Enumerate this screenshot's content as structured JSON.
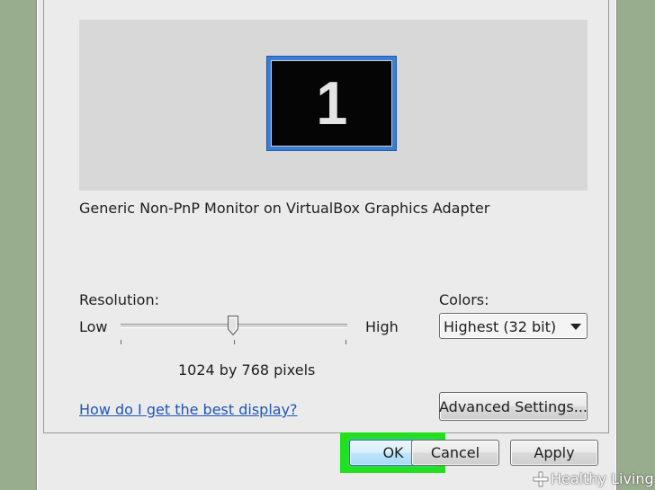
{
  "display": {
    "monitor_number": "1",
    "monitor_name": "Generic Non-PnP Monitor on VirtualBox Graphics Adapter"
  },
  "resolution": {
    "label": "Resolution:",
    "low_label": "Low",
    "high_label": "High",
    "value_text": "1024 by 768 pixels",
    "slider_fraction": 0.5
  },
  "colors": {
    "label": "Colors:",
    "selected": "Highest (32 bit)"
  },
  "help_link": "How do I get the best display?",
  "buttons": {
    "advanced": "Advanced Settings...",
    "ok": "OK",
    "cancel": "Cancel",
    "apply": "Apply"
  },
  "watermark": {
    "text": "Healthy Living"
  },
  "theme": {
    "highlight": "#22e01e",
    "link": "#1f56b8",
    "monitor_accent": "#3a7cd6"
  }
}
